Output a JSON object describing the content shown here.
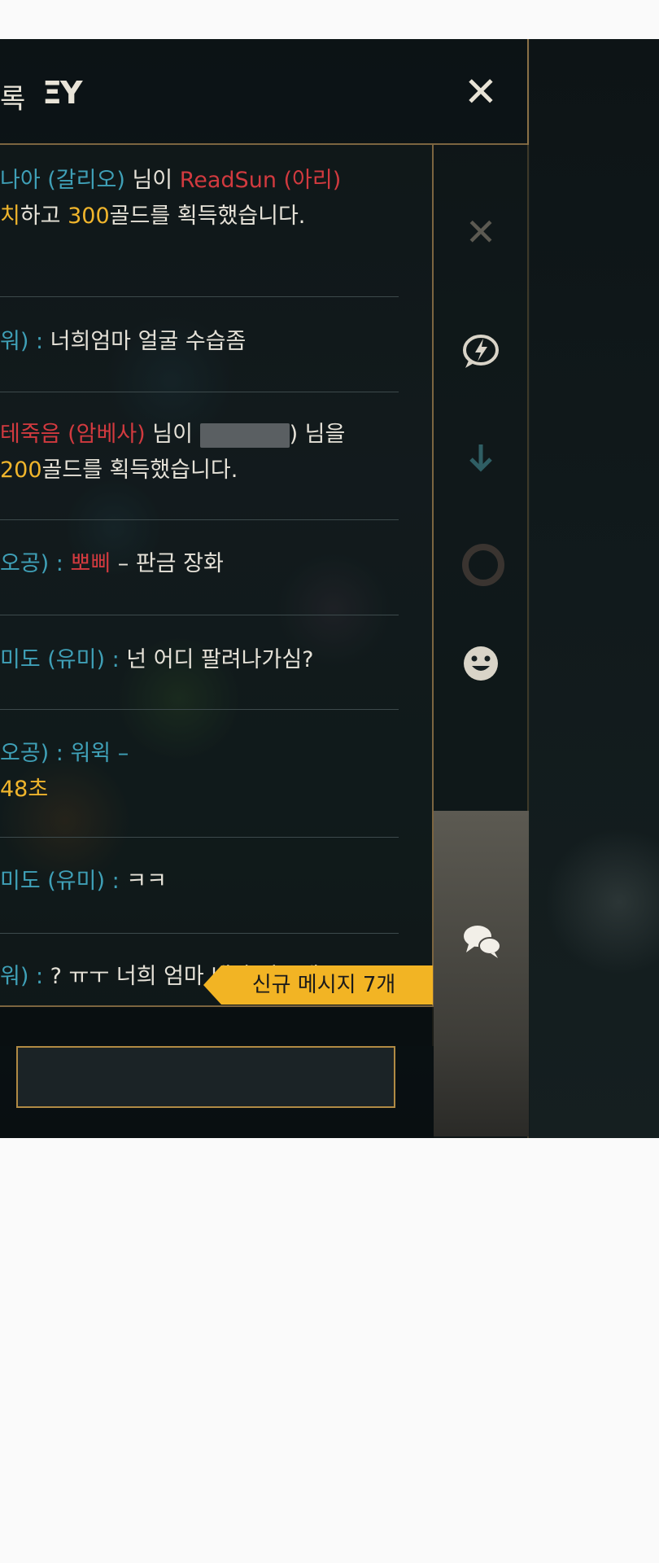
{
  "header": {
    "tab_label": "록",
    "logo_text": "ΞY",
    "close_label": "✕"
  },
  "messages": [
    {
      "line1": [
        {
          "text": "나아 (갈리오)",
          "color": "blue"
        },
        {
          "text": " 님이 ",
          "color": "white"
        },
        {
          "text": "ReadSun (아리)",
          "color": "red"
        }
      ],
      "line2": [
        {
          "text": "치",
          "color": "gold"
        },
        {
          "text": "하고 ",
          "color": "white"
        },
        {
          "text": "300",
          "color": "gold"
        },
        {
          "text": "골드를 획득했습니다.",
          "color": "white"
        }
      ]
    },
    {
      "line1": [
        {
          "text": "워)",
          "color": "blue"
        },
        {
          "text": " : ",
          "color": "blue"
        },
        {
          "text": "너희엄마 얼굴 수습좀",
          "color": "white"
        }
      ]
    },
    {
      "line1": [
        {
          "text": "테죽음 (암베사)",
          "color": "red"
        },
        {
          "text": " 님이 ",
          "color": "white"
        },
        {
          "text": "[redacted]",
          "color": "redacted"
        },
        {
          "text": ") 님을",
          "color": "white"
        }
      ],
      "line2": [
        {
          "text": "200",
          "color": "gold"
        },
        {
          "text": "골드를 획득했습니다.",
          "color": "white"
        }
      ]
    },
    {
      "line1": [
        {
          "text": "오공)",
          "color": "blue"
        },
        {
          "text": " : ",
          "color": "blue"
        },
        {
          "text": "뽀삐",
          "color": "red"
        },
        {
          "text": " – 판금 장화",
          "color": "white"
        }
      ]
    },
    {
      "line1": [
        {
          "text": "미도 (유미)",
          "color": "blue"
        },
        {
          "text": " : ",
          "color": "blue"
        },
        {
          "text": "넌 어디 팔려나가심?",
          "color": "white"
        }
      ]
    },
    {
      "line1": [
        {
          "text": "오공)",
          "color": "blue"
        },
        {
          "text": " : ",
          "color": "blue"
        },
        {
          "text": "워윅 –",
          "color": "blue"
        }
      ],
      "line2": [
        {
          "text": "48초",
          "color": "gold"
        }
      ]
    },
    {
      "line1": [
        {
          "text": "미도 (유미)",
          "color": "blue"
        },
        {
          "text": " : ",
          "color": "blue"
        },
        {
          "text": "ㅋㅋ",
          "color": "white"
        }
      ]
    },
    {
      "line1": [
        {
          "text": "워)",
          "color": "blue"
        },
        {
          "text": " : ",
          "color": "blue"
        },
        {
          "text": "? ㅠㅜ 너희 엄마 내가 샀는데?",
          "color": "white"
        }
      ]
    }
  ],
  "new_messages_badge": "신규 메시지 7개",
  "sidebar": {
    "icons": [
      "close-x-icon",
      "lightning-chat-icon",
      "scroll-down-icon",
      "ring-icon",
      "emoji-icon",
      "chat-bubbles-icon"
    ]
  },
  "chat_input": {
    "value": "",
    "placeholder": ""
  },
  "colors": {
    "blue": "#3fa0b7",
    "red": "#d23a3f",
    "gold": "#f0b52c",
    "white": "#e6e2d8",
    "border": "#8a7046",
    "badge": "#f2b424"
  }
}
